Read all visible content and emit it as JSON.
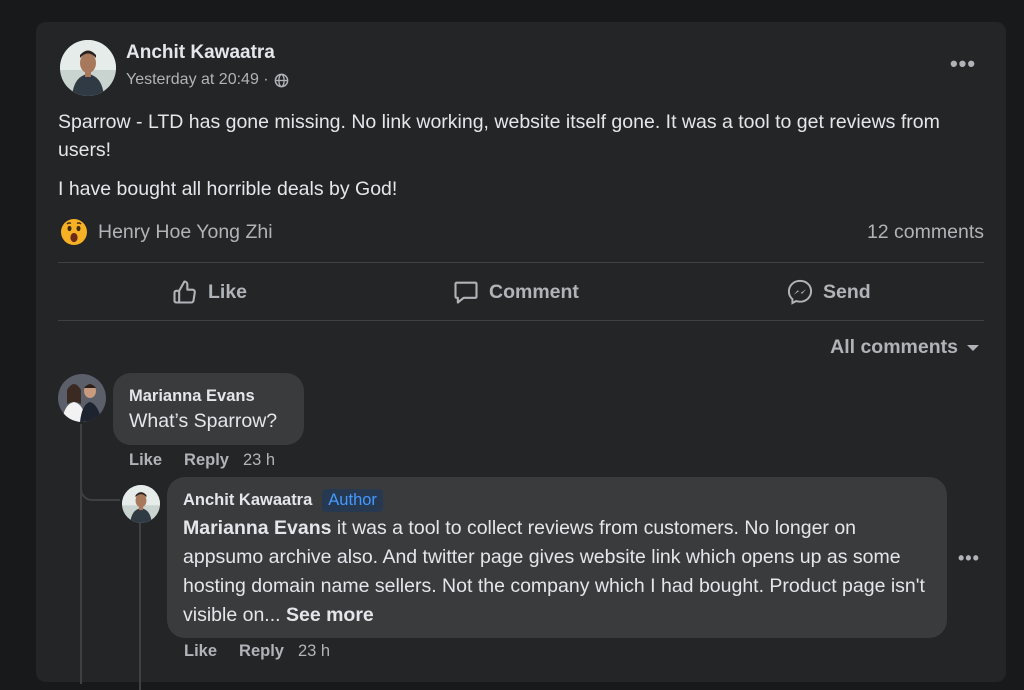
{
  "post": {
    "author": "Anchit Kawaatra",
    "timestamp": "Yesterday at 20:49 ·",
    "privacy_icon": "globe-icon",
    "paragraphs": [
      "Sparrow - LTD has gone missing. No link working, website itself gone. It was a tool to get reviews from users!",
      "I have bought all horrible deals by God!"
    ],
    "reaction_icon": "wow-icon",
    "reactor": "Henry Hoe Yong Zhi",
    "comment_count": "12 comments",
    "actions": {
      "like": "Like",
      "comment": "Comment",
      "send": "Send"
    },
    "filter": "All comments"
  },
  "comments": [
    {
      "name": "Marianna Evans",
      "text": "What’s Sparrow?",
      "like": "Like",
      "reply": "Reply",
      "time": "23 h"
    },
    {
      "name": "Anchit Kawaatra",
      "badge": "Author",
      "mention": "Marianna Evans",
      "text": " it was a tool to collect reviews from customers. No longer on appsumo archive also. And twitter page gives website link which opens up as some hosting domain name sellers. Not the company which I had bought. Product page isn't visible on... ",
      "see_more": "See more",
      "like": "Like",
      "reply": "Reply",
      "time": "23 h"
    }
  ],
  "colors": {
    "background": "#18191a",
    "card": "#242526",
    "bubble": "#3a3b3c",
    "text_primary": "#e4e6eb",
    "text_secondary": "#b0b3b8",
    "author_badge": "#4599ff"
  }
}
